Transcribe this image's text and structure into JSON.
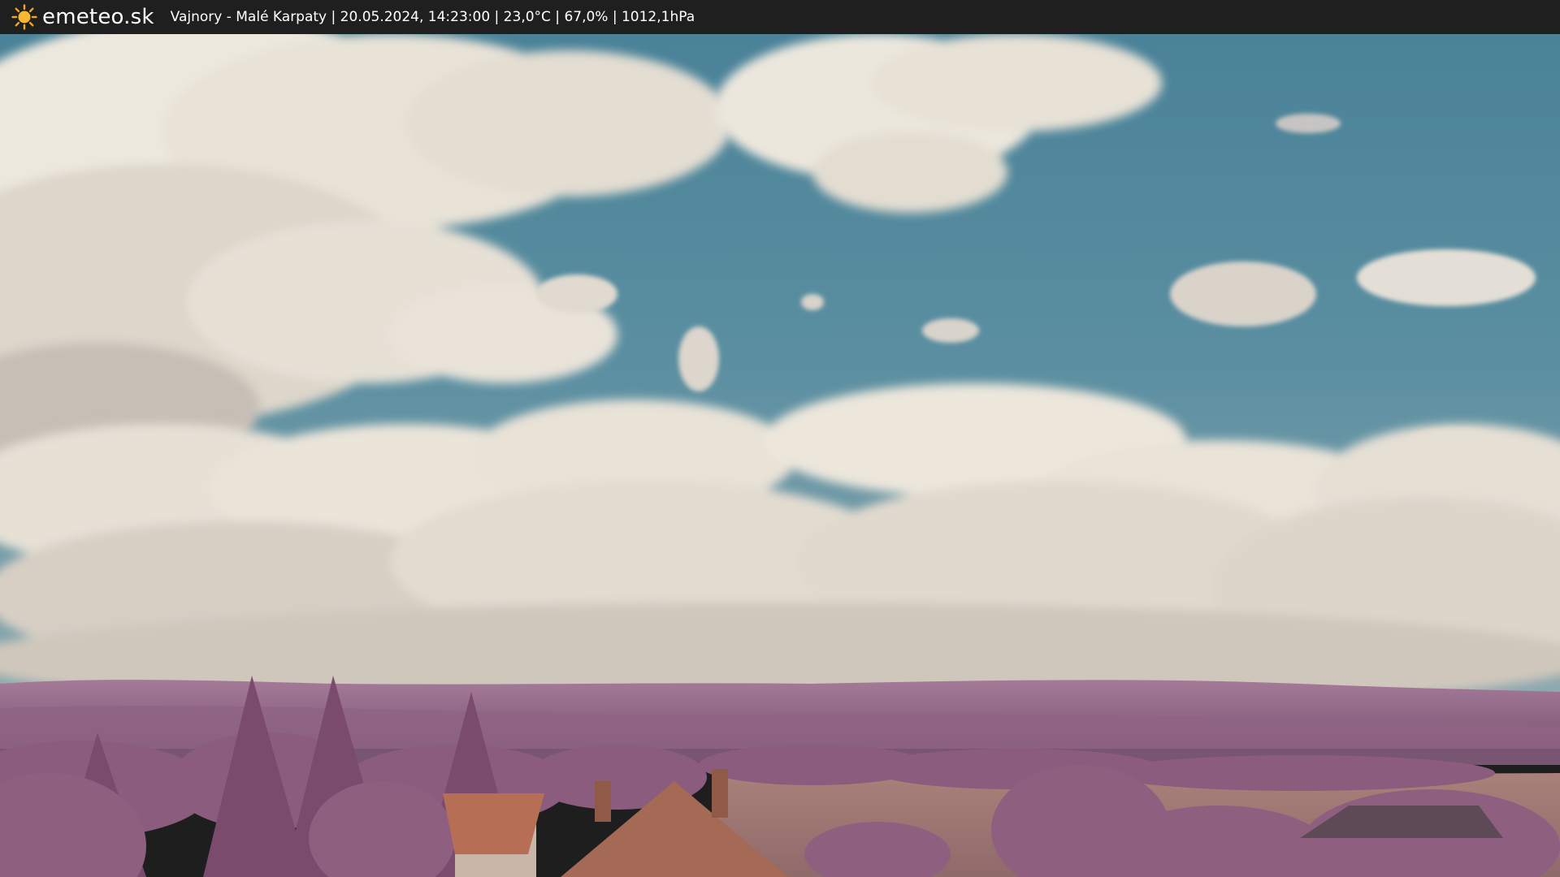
{
  "header": {
    "brand": "emeteo.sk",
    "caption": "Vajnory - Malé Karpaty | 20.05.2024, 14:23:00 | 23,0°C | 67,0% | 1012,1hPa",
    "logo_icon": "sun-icon",
    "background_color": "#1f1f1f",
    "text_color": "#ffffff"
  },
  "scene": {
    "description_colors": {
      "sky": "#4f8aa0",
      "clouds": "#ece7dc",
      "hills": "#9a6f91",
      "trees": "#8a5a7a",
      "roof": "#a86a4f"
    }
  }
}
